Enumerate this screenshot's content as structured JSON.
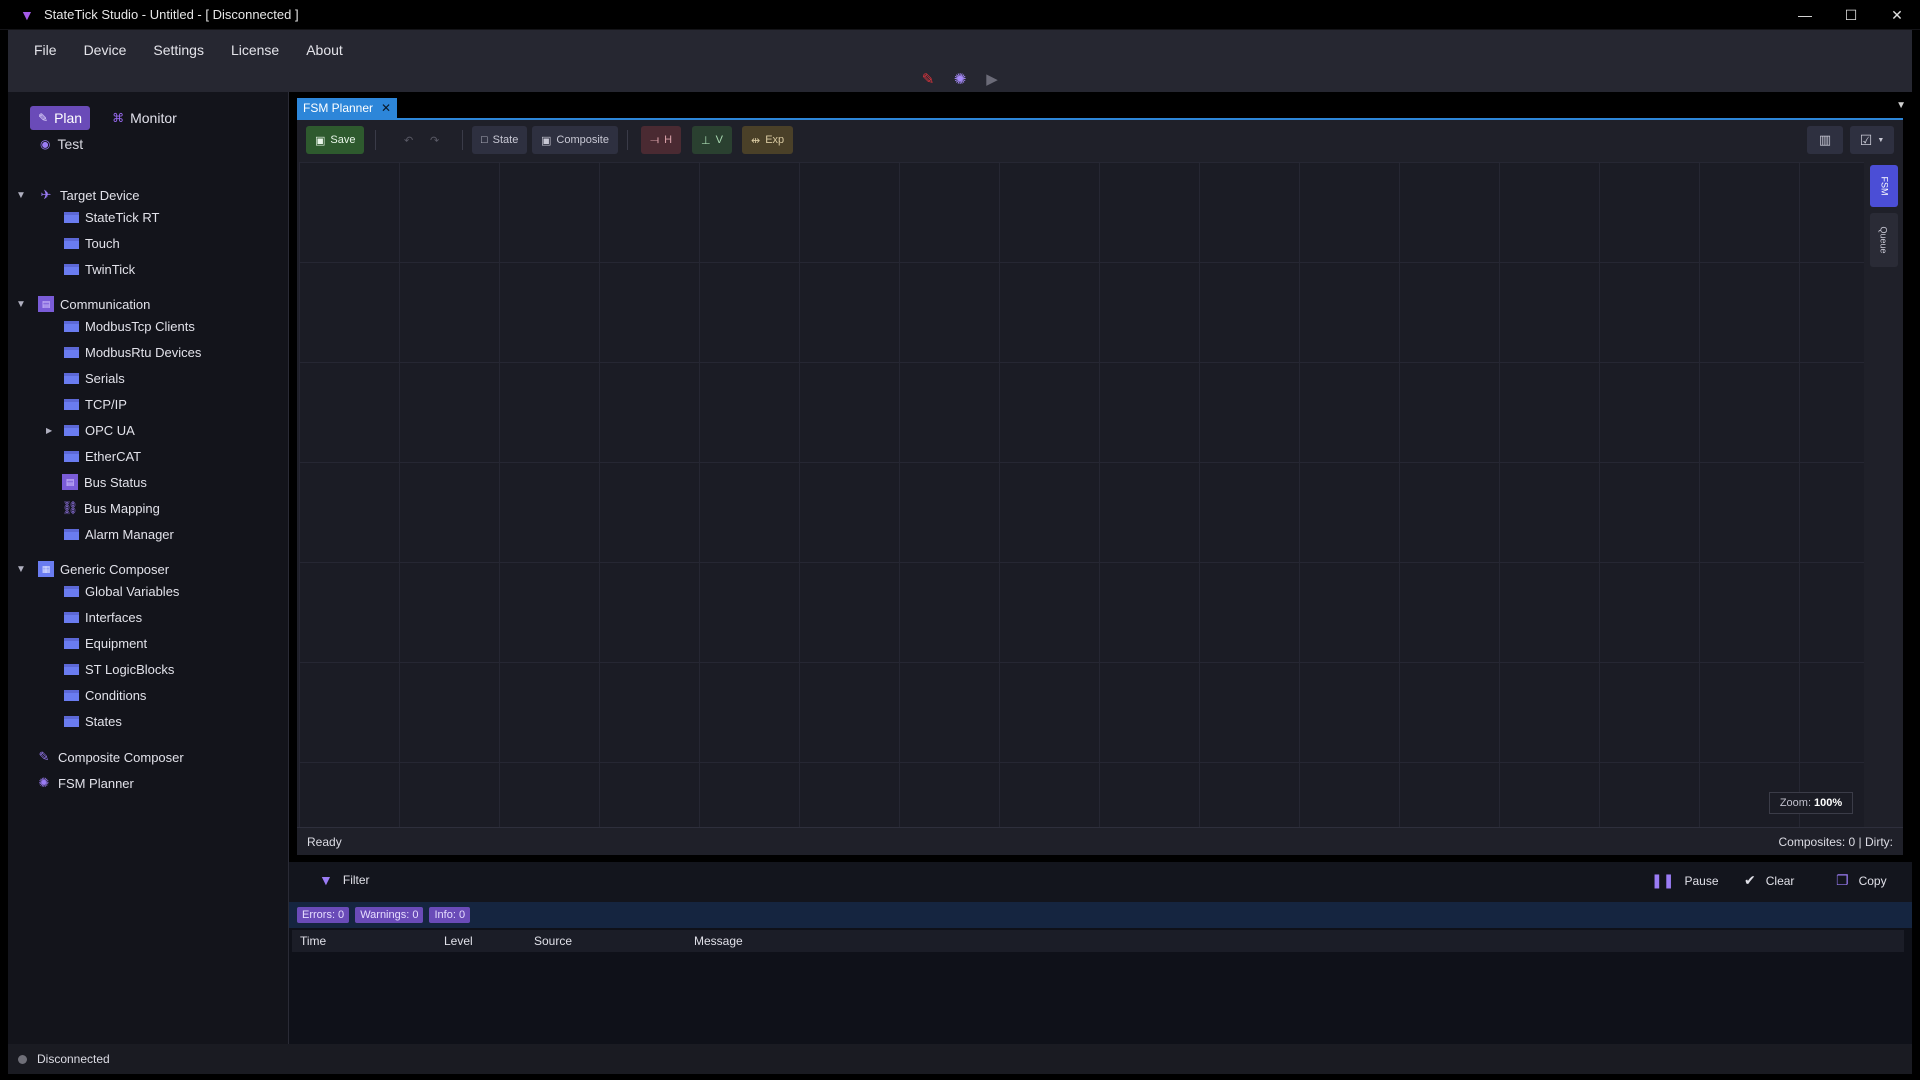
{
  "window": {
    "title": "StateTick Studio  -  Untitled  -  [ Disconnected ]",
    "controls": {
      "minimize": "—",
      "maximize": "☐",
      "close": "✕"
    }
  },
  "menu": [
    "File",
    "Device",
    "Settings",
    "License",
    "About"
  ],
  "conn_icons": [
    "connect-plug-icon",
    "gear-icon",
    "play-icon"
  ],
  "modes": {
    "plan": "Plan",
    "monitor": "Monitor",
    "test": "Test"
  },
  "tree": {
    "target_device": {
      "label": "Target Device",
      "children": [
        "StateTick RT",
        "Touch",
        "TwinTick"
      ]
    },
    "communication": {
      "label": "Communication",
      "children": [
        "ModbusTcp Clients",
        "ModbusRtu Devices",
        "Serials",
        "TCP/IP",
        "OPC UA",
        "EtherCAT",
        "Bus Status",
        "Bus Mapping",
        "Alarm Manager"
      ]
    },
    "generic_composer": {
      "label": "Generic Composer",
      "children": [
        "Global Variables",
        "Interfaces",
        "Equipment",
        "ST LogicBlocks",
        "Conditions",
        "States"
      ]
    },
    "composite_composer": "Composite Composer",
    "fsm_planner": "FSM Planner"
  },
  "tab": {
    "label": "FSM Planner",
    "close": "✕"
  },
  "toolbar": {
    "save": "Save",
    "state": "State",
    "composite": "Composite",
    "h": "H",
    "v": "V",
    "exp": "Exp"
  },
  "side_tabs": [
    "FSM",
    "Queue"
  ],
  "zoom": {
    "label": "Zoom:",
    "value": "100%"
  },
  "editor_status": {
    "left": "Ready",
    "right": "Composites: 0 | Dirty:"
  },
  "log": {
    "filter": "Filter",
    "pause": "Pause",
    "clear": "Clear",
    "copy": "Copy",
    "badges": [
      "Errors: 0",
      "Warnings: 0",
      "Info: 0"
    ],
    "columns": [
      "Time",
      "Level",
      "Source",
      "Message"
    ]
  },
  "status": {
    "connection": "Disconnected"
  },
  "colors": {
    "accent": "#2d86d9",
    "mode_active": "#6a4bb8",
    "folder": "#6a7cf0",
    "save_green": "#2e5a2e"
  }
}
